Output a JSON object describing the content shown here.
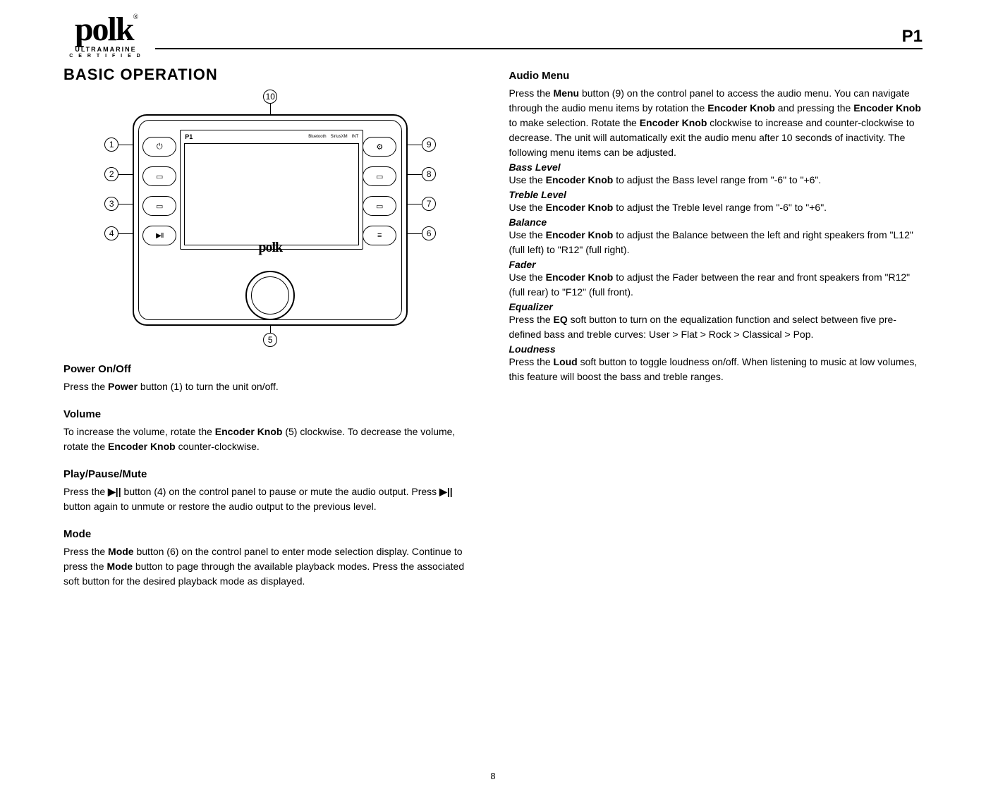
{
  "header": {
    "brand": "polk",
    "brand_sub1": "ULTRAMARINE",
    "brand_sub2": "C E R T I F I E D",
    "model": "P1"
  },
  "page_number": "8",
  "diagram": {
    "screen_model": "P1",
    "status_icons": [
      "Bluetooth",
      "SiriusXM",
      "INT"
    ],
    "center_brand": "polk",
    "callouts": [
      "1",
      "2",
      "3",
      "4",
      "5",
      "6",
      "7",
      "8",
      "9",
      "10"
    ],
    "left_buttons_icons": [
      "power",
      "flat",
      "flat",
      "playpause"
    ],
    "right_buttons_icons": [
      "gear",
      "flat",
      "flat",
      "menu"
    ]
  },
  "left_column": {
    "main_heading": "BASIC OPERATION",
    "sections": [
      {
        "heading": "Power On/Off",
        "body_pre": "Press the ",
        "body_b1": "Power",
        "body_post": " button (1) to turn the unit on/off."
      },
      {
        "heading": "Volume",
        "body_pre": "To increase the volume, rotate the ",
        "body_b1": "Encoder Knob",
        "body_mid": " (5) clockwise. To decrease the volume, rotate the ",
        "body_b2": "Encoder Knob",
        "body_post": " counter-clockwise."
      },
      {
        "heading": "Play/Pause/Mute",
        "body_pre": "Press the ",
        "body_sym1": "▶||",
        "body_mid": " button (4) on the control panel to pause or mute the audio output. Press ",
        "body_sym2": "▶||",
        "body_post": " button again to unmute or restore the audio output to the previous level."
      },
      {
        "heading": "Mode",
        "body_pre": "Press the ",
        "body_b1": "Mode",
        "body_mid": " button (6) on the control panel to enter mode selection display. Continue to press the ",
        "body_b2": "Mode",
        "body_post": " button to page through the available playback modes. Press the associated soft button for the desired playback mode as displayed."
      }
    ]
  },
  "right_column": {
    "heading": "Audio Menu",
    "intro_pre": "Press the ",
    "intro_b1": "Menu",
    "intro_mid1": " button (9) on the control panel to access the audio menu. You can navigate through the audio menu items by rotation the ",
    "intro_b2": "Encoder Knob",
    "intro_mid2": " and pressing the ",
    "intro_b3": "Encoder Knob",
    "intro_mid3": " to make selection. Rotate the ",
    "intro_b4": "Encoder Knob",
    "intro_post": " clockwise to increase and counter-clockwise to decrease. The unit will automatically exit the audio menu after 10 seconds of inactivity. The following menu items can be adjusted.",
    "items": [
      {
        "sub": "Bass Level",
        "pre": "Use the ",
        "b1": "Encoder Knob",
        "post": " to adjust the Bass level range from \"-6\" to \"+6\"."
      },
      {
        "sub": "Treble Level",
        "pre": "Use the ",
        "b1": "Encoder Knob",
        "post": " to adjust the Treble level range from \"-6\" to \"+6\"."
      },
      {
        "sub": "Balance",
        "pre": "Use the ",
        "b1": "Encoder Knob",
        "post": " to adjust the Balance between the left and right speakers from \"L12\" (full left) to \"R12\" (full right)."
      },
      {
        "sub": "Fader",
        "pre": "Use the ",
        "b1": "Encoder Knob",
        "post": " to adjust the Fader between the rear and front speakers from \"R12\" (full rear) to \"F12\" (full front)."
      },
      {
        "sub": "Equalizer",
        "pre": "Press the ",
        "b1": "EQ",
        "post": " soft button to turn on the equalization function and select between five pre-defined bass and treble curves: User > Flat > Rock > Classical > Pop."
      },
      {
        "sub": "Loudness",
        "pre": "Press the ",
        "b1": "Loud",
        "post": " soft button to toggle loudness on/off. When listening to music at low volumes, this feature will boost the bass and treble ranges."
      }
    ]
  }
}
